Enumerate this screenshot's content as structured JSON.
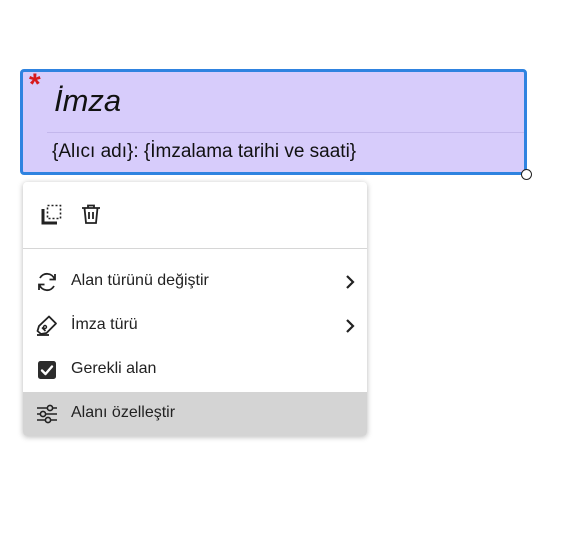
{
  "signature_field": {
    "required_mark": "*",
    "title": "İmza",
    "subtitle": "{Alıcı adı}: {İmzalama tarihi ve saati}",
    "fill_color": "#d7ccfb",
    "border_color": "#2f83e0"
  },
  "context_menu": {
    "toolbar": {
      "icons": [
        "duplicate-icon",
        "trash-icon"
      ]
    },
    "items": [
      {
        "label": "Alan türünü değiştir",
        "icon": "refresh-icon",
        "has_submenu": true
      },
      {
        "label": "İmza türü",
        "icon": "pen-icon",
        "has_submenu": true
      },
      {
        "label": "Gerekli alan",
        "icon": "checkbox-checked-icon",
        "checked": true
      },
      {
        "label": "Alanı özelleştir",
        "icon": "sliders-icon",
        "highlighted": true
      }
    ]
  }
}
